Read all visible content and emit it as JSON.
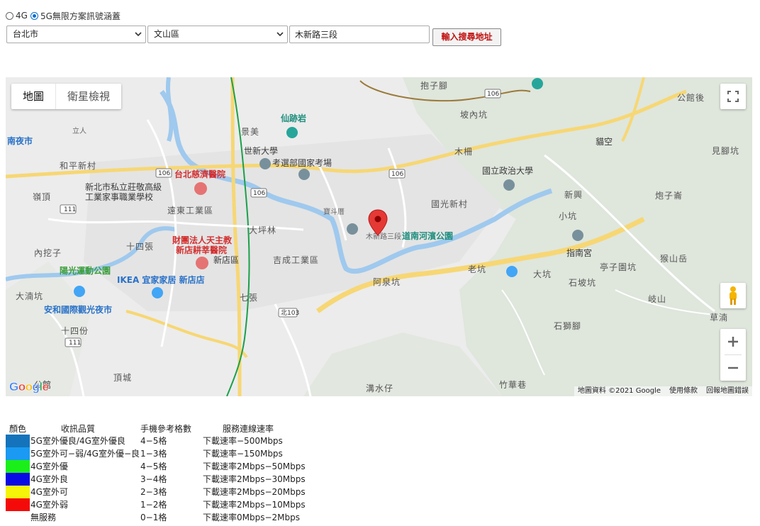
{
  "network_options": [
    {
      "label": "4G",
      "checked": false
    },
    {
      "label": "5G無限方案訊號涵蓋",
      "checked": true
    }
  ],
  "address_form": {
    "city": "台北市",
    "district": "文山區",
    "street": "木新路三段",
    "submit_label": "輸入搜尋地址"
  },
  "map": {
    "type_tabs": [
      {
        "label": "地圖",
        "active": true
      },
      {
        "label": "衛星檢視",
        "active": false
      }
    ],
    "attribution": {
      "data": "地圖資料 ©2021 Google",
      "terms": "使用條款",
      "report": "回報地圖錯誤"
    },
    "logo": "Google",
    "labels": {
      "l1": "南夜市",
      "l2": "和平新村",
      "l3": "嶺頂",
      "l4": "新北市私立莊敬高級",
      "l5": "工業家事職業學校",
      "l6": "台北慈濟醫院",
      "l7": "遠東工業區",
      "l8": "十四張",
      "l9": "財團法人天主教",
      "l10": "新店耕莘醫院",
      "l11": "陽光運動公園",
      "l12": "IKEA 宜家家居 新店店",
      "l13": "大湳坑",
      "l14": "安和國際觀光夜市",
      "l15": "十四份",
      "l16": "頂城",
      "l17": "公館",
      "l18": "內挖子",
      "l19": "大坪林",
      "l20": "新店區",
      "l21": "吉成工業區",
      "l22": "七張",
      "l23": "景美",
      "l24": "世新大學",
      "l25": "考選部國家考場",
      "l26": "仙跡岩",
      "l27": "寶斗厝",
      "l28": "抱子腳",
      "l29": "坡內坑",
      "l30": "木柵",
      "l31": "國立政治大學",
      "l32": "國光新村",
      "l33": "道南河濱公園",
      "l34": "老坑",
      "l35": "阿泉坑",
      "l36": "大坑",
      "l37": "石坡坑",
      "l38": "石獅腳",
      "l39": "溝水仔",
      "l40": "竹華巷",
      "l41": "指南宮",
      "l42": "新興",
      "l43": "小坑",
      "l44": "亭子園坑",
      "l45": "猴山岳",
      "l46": "岐山",
      "l47": "草湳",
      "l48": "炮子崙",
      "l49": "貓空",
      "l50": "見腳坑",
      "l51": "公館後",
      "l52": "木新路三段",
      "l53": "立人",
      "l54": "北103",
      "r1": "106",
      "r2": "106",
      "r3": "106",
      "r4": "106",
      "r5": "111",
      "r6": "111",
      "r7": "106"
    }
  },
  "legend": {
    "headers": [
      "顏色",
      "收訊品質",
      "手機參考格數",
      "服務連線速率"
    ],
    "rows": [
      {
        "color": "#1473bb",
        "quality": "5G室外優良/4G室外優良",
        "bars": "4−5格",
        "speed": "下載速率−500Mbps"
      },
      {
        "color": "#1a9af2",
        "quality": "5G室外可−弱/4G室外優−良",
        "bars": "1−3格",
        "speed": "下載速率−150Mbps"
      },
      {
        "color": "#1aef1a",
        "quality": "4G室外優",
        "bars": "4−5格",
        "speed": "下載速率2Mbps−50Mbps"
      },
      {
        "color": "#0a0ae6",
        "quality": "4G室外良",
        "bars": "3−4格",
        "speed": "下載速率2Mbps−30Mbps"
      },
      {
        "color": "#f5f50a",
        "quality": "4G室外可",
        "bars": "2−3格",
        "speed": "下載速率2Mbps−20Mbps"
      },
      {
        "color": "#f50a0a",
        "quality": "4G室外弱",
        "bars": "1−2格",
        "speed": "下載速率2Mbps−10Mbps"
      },
      {
        "color": "",
        "quality": "無服務",
        "bars": "0−1格",
        "speed": "下載速率0Mbps−2Mbps"
      }
    ]
  }
}
